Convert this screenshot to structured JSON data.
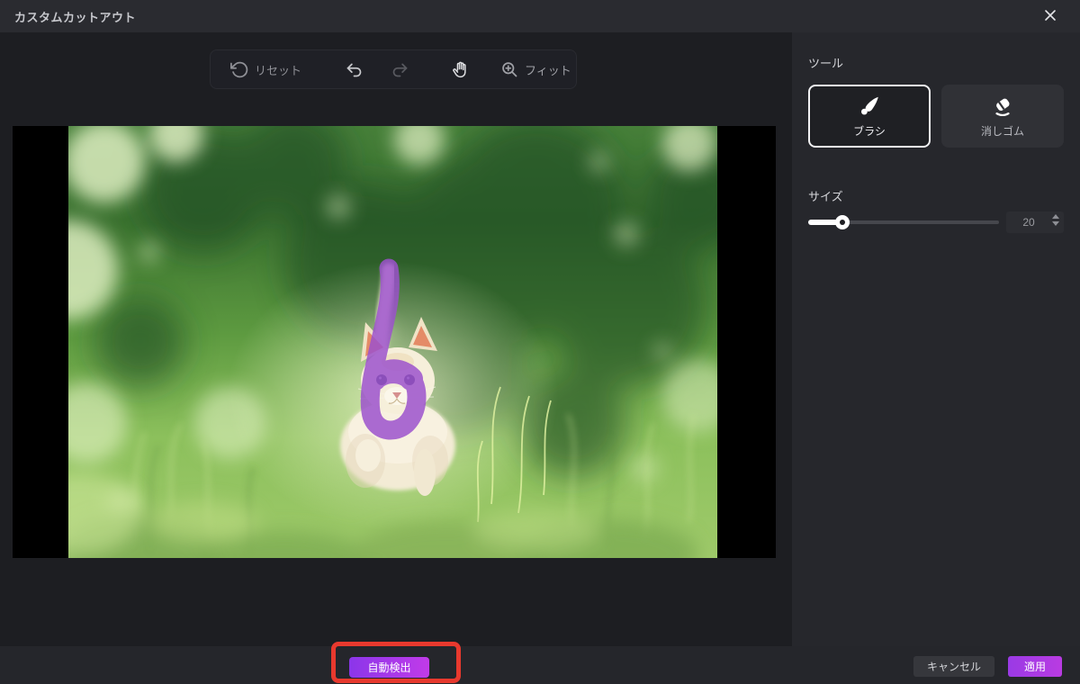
{
  "window": {
    "title": "カスタムカットアウト"
  },
  "toolbar": {
    "reset": "リセット",
    "fit": "フィット"
  },
  "tools_panel": {
    "section_tools": "ツール",
    "brush": "ブラシ",
    "eraser": "消しゴム",
    "section_size": "サイズ",
    "size_value": "20"
  },
  "footer": {
    "auto_detect": "自動検出",
    "cancel": "キャンセル",
    "apply": "適用"
  },
  "icons": {
    "close": "close-icon",
    "reset": "reset-icon",
    "undo": "undo-icon",
    "redo": "redo-icon",
    "hand": "hand-icon",
    "zoom_fit": "zoom-fit-icon",
    "brush": "brush-icon",
    "eraser": "eraser-icon"
  },
  "colors": {
    "accent_gradient_start": "#8b36e9",
    "accent_gradient_end": "#c13be9",
    "annotation_red": "#e8392e",
    "brush_stroke_purple": "#9c51cd",
    "selected_tool_border": "#f2f2f4"
  }
}
